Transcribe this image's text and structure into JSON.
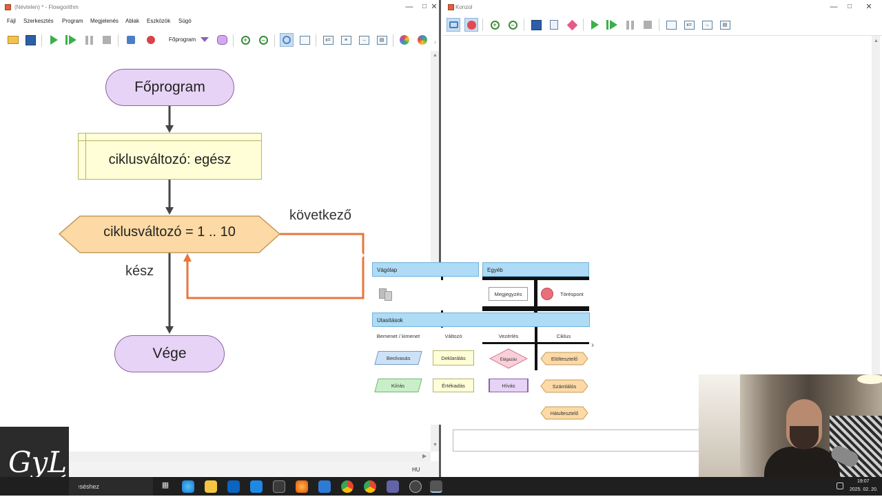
{
  "left_window": {
    "title": "(Névtelen) * - Flowgorithm",
    "menu": [
      "Fájl",
      "Szerkesztés",
      "Program",
      "Megjelenés",
      "Ablak",
      "Eszközök",
      "Súgó"
    ],
    "toolbar": {
      "function_select": "Főprogram"
    },
    "status_lang": "HU"
  },
  "flowchart": {
    "start": "Főprogram",
    "declaration": "ciklusváltozó: egész",
    "loop": "ciklusváltozó = 1 .. 10",
    "next_label": "következő",
    "done_label": "kész",
    "end": "Vége"
  },
  "right_window": {
    "title": "Konzol"
  },
  "palette": {
    "clipboard_header": "Vágólap",
    "other_header": "Egyéb",
    "comment": "Megjegyzés",
    "breakpoint": "Töréspont",
    "statements_header": "Utasítások",
    "col_io": "Bemenet / kimenet",
    "col_var": "Változó",
    "col_control": "Vezérlés",
    "col_loop": "Ciklus",
    "input": "Beolvasás",
    "declare": "Deklarálás",
    "if": "Elágazás",
    "while": "Elöltesztelő",
    "output": "Kiírás",
    "assign": "Értékadás",
    "call": "Hívás",
    "for": "Számlálós",
    "do": "Hátultesztelő"
  },
  "taskbar": {
    "search_placeholder": "Írjon ide a kereséshez",
    "time": "19:07",
    "date": "2025. 02. 20."
  },
  "logo_text": "GyL",
  "colors": {
    "orange_arrow": "#e8763a",
    "terminal_fill": "#e7d3f5",
    "decl_fill": "#fffed6",
    "loop_fill": "#fcd9a5",
    "palette_header": "#aedbf5"
  }
}
